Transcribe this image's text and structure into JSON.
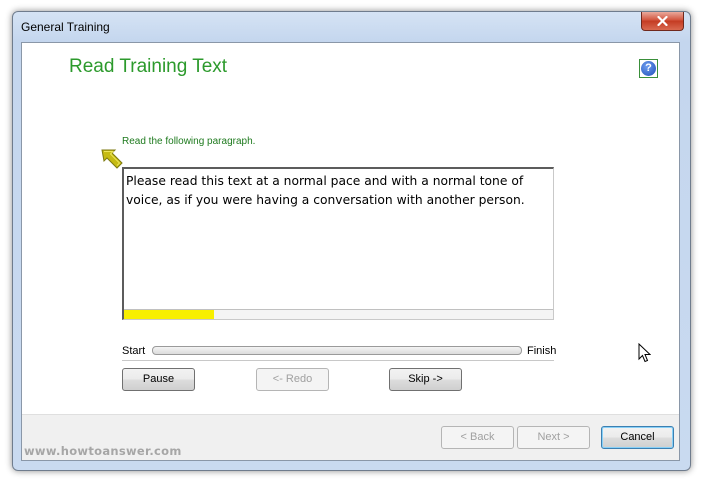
{
  "window": {
    "title": "General Training",
    "close_icon": "close-x"
  },
  "page": {
    "title": "Read Training Text",
    "help_icon": "question-mark",
    "help_glyph": "?"
  },
  "instruction": "Read the following paragraph.",
  "pointer_icon": "yellow-arrow",
  "training_text": "Please read this text at a normal pace and with a normal tone of voice, as if you were having a conversation with another person.",
  "paragraph_progress": 0.21,
  "overall_progress": {
    "start_label": "Start",
    "finish_label": "Finish",
    "value": 0.0
  },
  "controls": {
    "pause_label": "Pause",
    "redo_label": "<- Redo",
    "skip_label": "Skip ->"
  },
  "footer": {
    "back_label": "< Back",
    "next_label": "Next >",
    "cancel_label": "Cancel"
  },
  "watermark": "www.howtoanswer.com",
  "colors": {
    "title_green": "#2c9a2c",
    "progress_yellow": "#f8ef00",
    "help_blue": "#1f4fb8",
    "close_red": "#c43b22"
  }
}
